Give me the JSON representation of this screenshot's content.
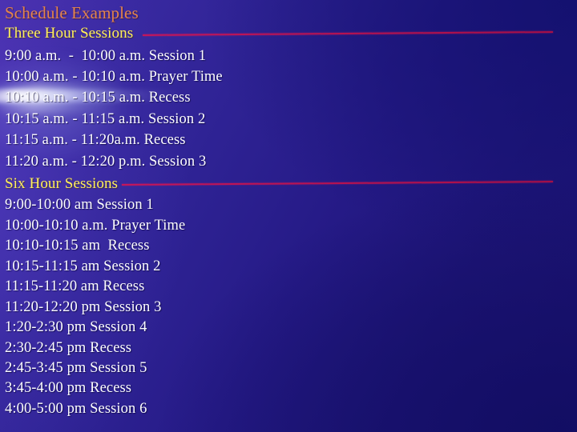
{
  "slide": {
    "title": "Schedule Examples",
    "background_colors": {
      "base": "#2b2191",
      "upper_left": "#4a2fae",
      "upper_right": "#201a86",
      "lower_right": "#1b1270",
      "lower_left": "#2a1f85"
    },
    "title_color": "#e3844e",
    "heading_color": "#ffef5e",
    "body_color": "#fdfdff",
    "rule_color": "#b5124f"
  },
  "sections": [
    {
      "heading": "Three Hour Sessions",
      "rows": [
        "9:00 a.m.  -  10:00 a.m. Session 1",
        "10:00 a.m. - 10:10 a.m. Prayer Time",
        "10:10 a.m. - 10:15 a.m. Recess",
        "10:15 a.m. - 11:15 a.m. Session 2",
        "11:15 a.m. - 11:20a.m. Recess",
        "11:20 a.m. - 12:20 p.m. Session 3"
      ]
    },
    {
      "heading": "Six Hour Sessions",
      "rows": [
        "9:00-10:00 am Session 1",
        "10:00-10:10 a.m. Prayer Time",
        "10:10-10:15 am  Recess",
        "10:15-11:15 am Session 2",
        "11:15-11:20 am Recess",
        "11:20-12:20 pm Session 3",
        "1:20-2:30 pm Session 4",
        "2:30-2:45 pm Recess",
        "2:45-3:45 pm Session 5",
        "3:45-4:00 pm Recess",
        "4:00-5:00 pm Session 6"
      ]
    }
  ]
}
